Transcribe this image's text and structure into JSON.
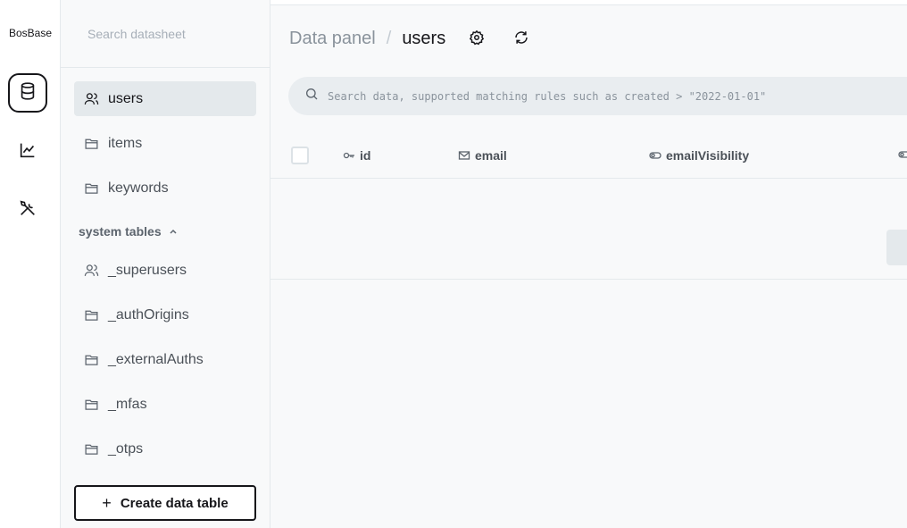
{
  "app": {
    "brand": "BosBase"
  },
  "rail": {
    "items": [
      {
        "icon": "database-icon",
        "active": true
      },
      {
        "icon": "chart-line-icon",
        "active": false
      },
      {
        "icon": "tools-icon",
        "active": false
      }
    ]
  },
  "sidebar": {
    "search_placeholder": "Search datasheet",
    "collections": [
      {
        "label": "users",
        "icon": "users-icon",
        "active": true
      },
      {
        "label": "items",
        "icon": "folder-icon",
        "active": false
      },
      {
        "label": "keywords",
        "icon": "folder-icon",
        "active": false
      }
    ],
    "system_section_label": "system tables",
    "system_collections": [
      {
        "label": "_superusers",
        "icon": "users-icon"
      },
      {
        "label": "_authOrigins",
        "icon": "folder-icon"
      },
      {
        "label": "_externalAuths",
        "icon": "folder-icon"
      },
      {
        "label": "_mfas",
        "icon": "folder-icon"
      },
      {
        "label": "_otps",
        "icon": "folder-icon"
      }
    ],
    "create_label": "Create data table"
  },
  "header": {
    "breadcrumb_root": "Data panel",
    "breadcrumb_sep": "/",
    "breadcrumb_current": "users"
  },
  "search": {
    "placeholder": "Search data, supported matching rules such as created > \"2022-01-01\""
  },
  "table": {
    "columns": [
      {
        "label": "id",
        "icon": "key-icon"
      },
      {
        "label": "email",
        "icon": "mail-icon"
      },
      {
        "label": "emailVisibility",
        "icon": "toggle-icon"
      }
    ]
  }
}
